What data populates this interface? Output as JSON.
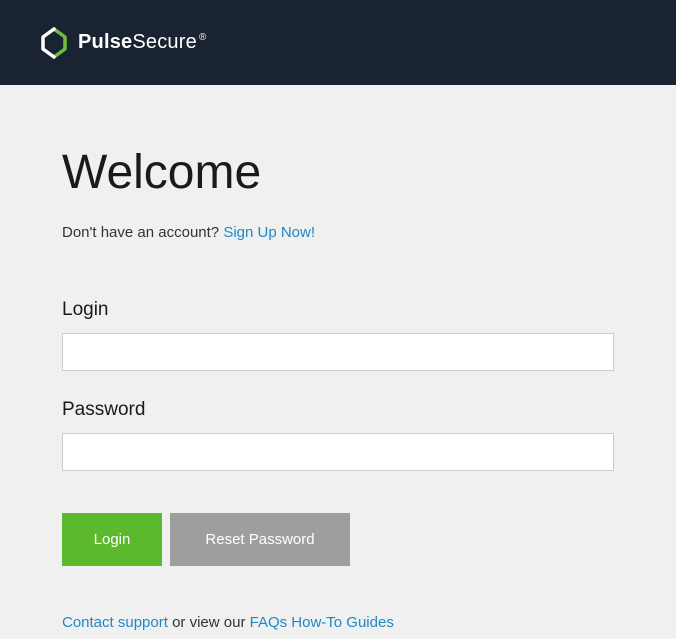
{
  "header": {
    "brand_bold": "Pulse",
    "brand_light": "Secure",
    "reg_mark": "®"
  },
  "main": {
    "title": "Welcome",
    "signup_prompt": "Don't have an account? ",
    "signup_link": "Sign Up Now!",
    "login_label": "Login",
    "login_value": "",
    "password_label": "Password",
    "password_value": "",
    "login_button": "Login",
    "reset_button": "Reset Password"
  },
  "footer": {
    "contact_link": "Contact support",
    "mid_text": " or view our ",
    "faq_link": "FAQs How-To Guides"
  },
  "colors": {
    "header_bg": "#1a2332",
    "accent_green": "#5cb82c",
    "link_blue": "#1e88c7",
    "gray_button": "#9e9e9e"
  }
}
